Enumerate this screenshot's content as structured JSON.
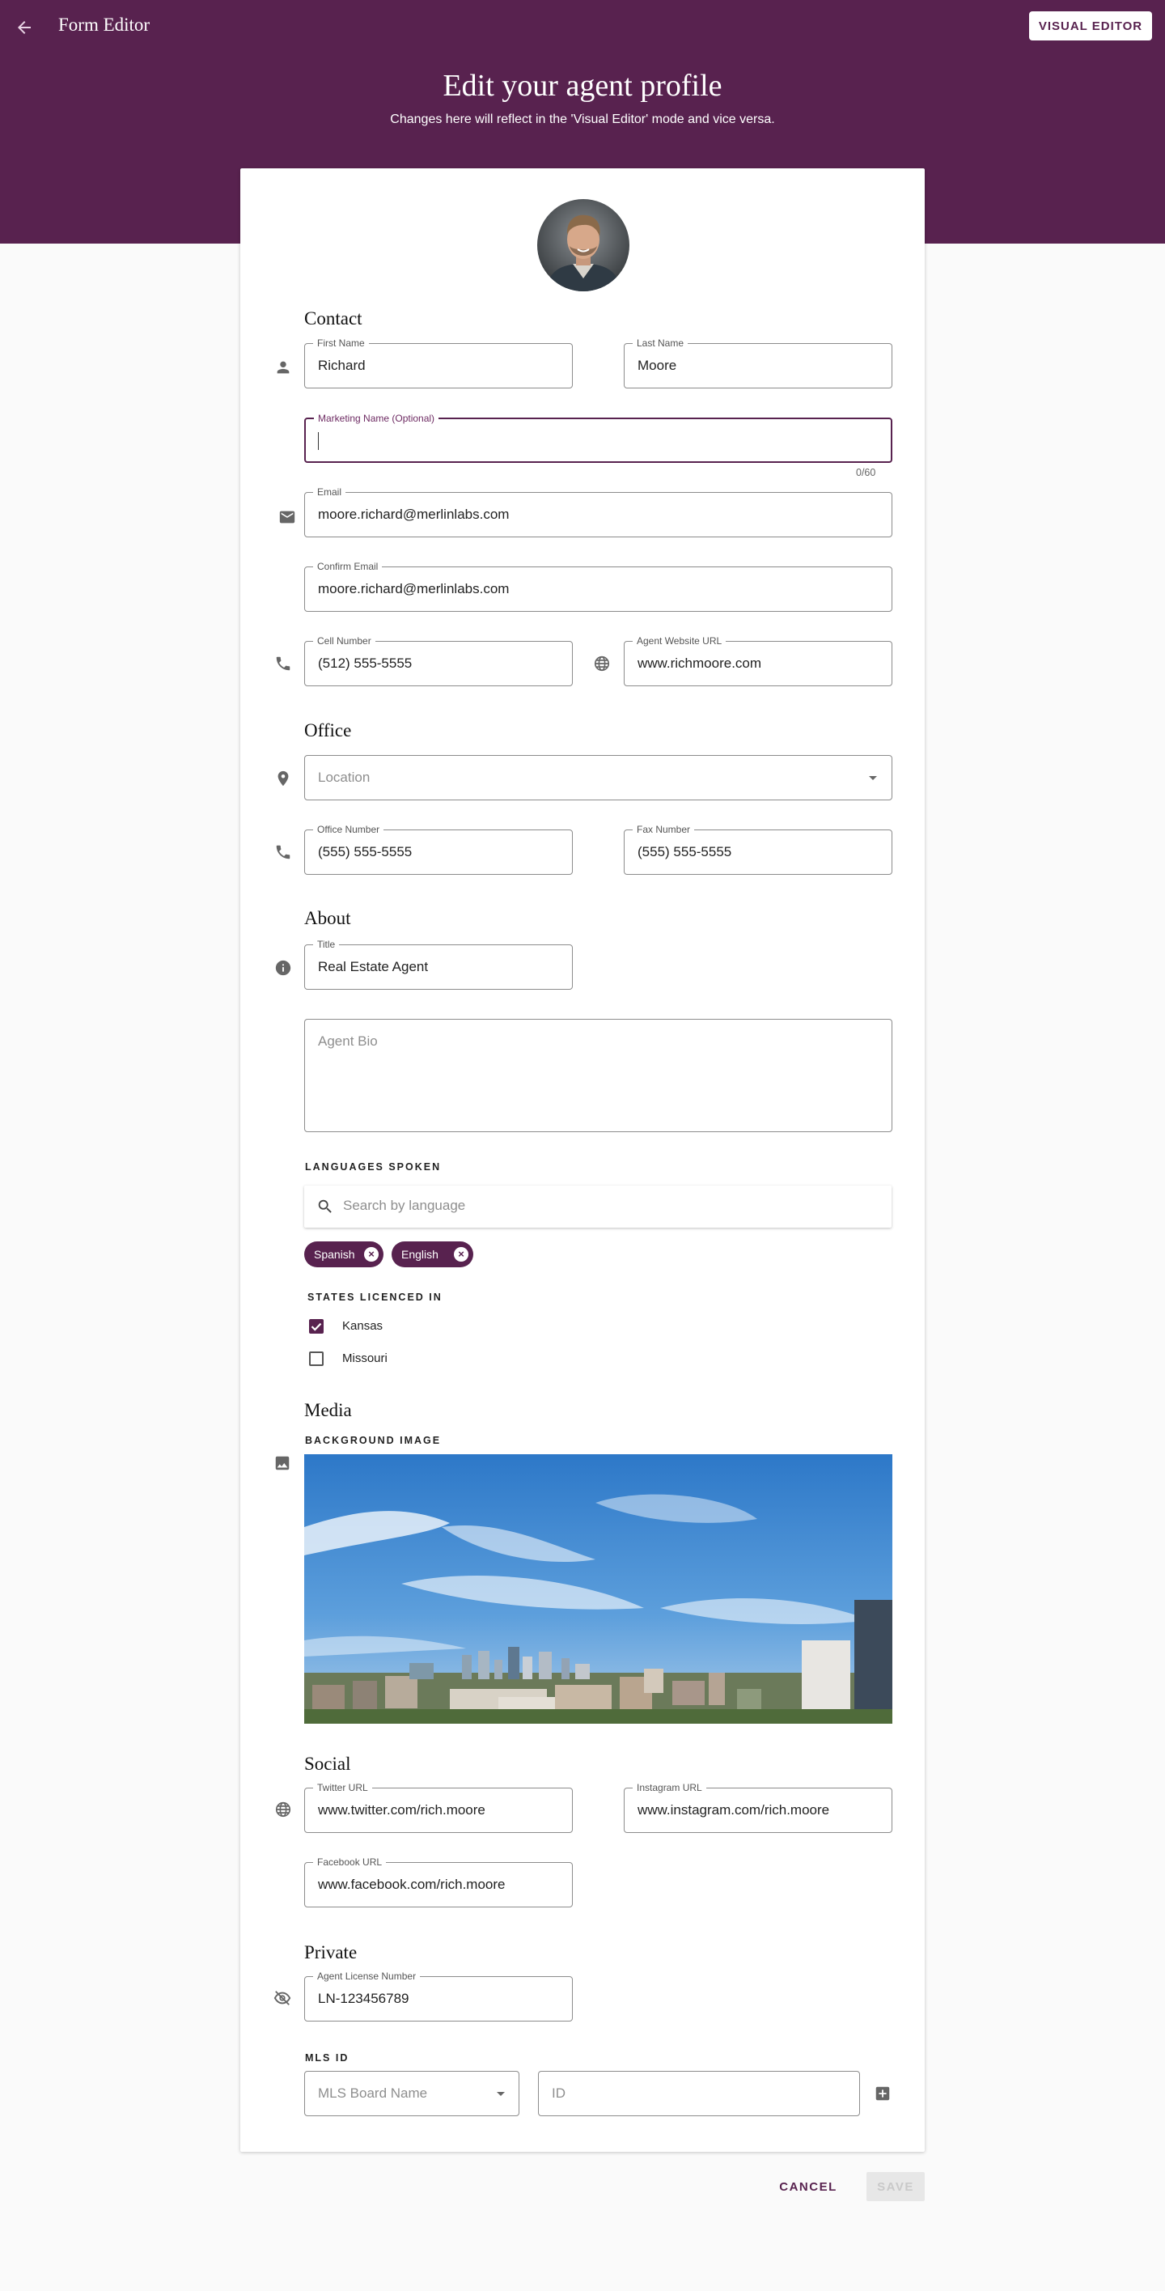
{
  "header": {
    "app_title": "Form Editor",
    "visual_editor_label": "VISUAL EDITOR",
    "page_title": "Edit your agent profile",
    "page_subtitle": "Changes here will reflect in the 'Visual Editor' mode and vice versa."
  },
  "contact": {
    "heading": "Contact",
    "first_name": {
      "label": "First Name",
      "value": "Richard"
    },
    "last_name": {
      "label": "Last Name",
      "value": "Moore"
    },
    "marketing_name": {
      "label": "Marketing Name (Optional)",
      "value": "",
      "counter": "0/60"
    },
    "email": {
      "label": "Email",
      "value": "moore.richard@merlinlabs.com"
    },
    "confirm_email": {
      "label": "Confirm Email",
      "value": "moore.richard@merlinlabs.com"
    },
    "cell_number": {
      "label": "Cell Number",
      "value": "(512) 555-5555"
    },
    "website": {
      "label": "Agent Website URL",
      "value": "www.richmoore.com"
    }
  },
  "office": {
    "heading": "Office",
    "location": {
      "placeholder": "Location"
    },
    "office_number": {
      "label": "Office Number",
      "value": "(555) 555-5555"
    },
    "fax_number": {
      "label": "Fax Number",
      "value": "(555) 555-5555"
    }
  },
  "about": {
    "heading": "About",
    "title": {
      "label": "Title",
      "value": "Real Estate Agent"
    },
    "bio": {
      "placeholder": "Agent Bio"
    },
    "languages_label": "LANGUAGES SPOKEN",
    "language_search": {
      "placeholder": "Search by language"
    },
    "languages": [
      {
        "label": "Spanish"
      },
      {
        "label": "English"
      }
    ],
    "states_label": "STATES LICENCED IN",
    "states": [
      {
        "label": "Kansas",
        "checked": true
      },
      {
        "label": "Missouri",
        "checked": false
      }
    ]
  },
  "media": {
    "heading": "Media",
    "background_label": "BACKGROUND IMAGE"
  },
  "social": {
    "heading": "Social",
    "twitter": {
      "label": "Twitter URL",
      "value": "www.twitter.com/rich.moore"
    },
    "instagram": {
      "label": "Instagram URL",
      "value": "www.instagram.com/rich.moore"
    },
    "facebook": {
      "label": "Facebook URL",
      "value": "www.facebook.com/rich.moore"
    }
  },
  "private": {
    "heading": "Private",
    "license": {
      "label": "Agent License Number",
      "value": "LN-123456789"
    },
    "mls_label": "MLS  ID",
    "mls_board": {
      "placeholder": "MLS Board Name"
    },
    "mls_id": {
      "placeholder": "ID"
    }
  },
  "actions": {
    "cancel_label": "CANCEL",
    "save_label": "SAVE"
  },
  "colors": {
    "brand": "#58224f",
    "header_bg": "#58224f",
    "page_bg": "#fafafa",
    "save_disabled_bg": "#e7e7e7"
  },
  "icons": [
    "back-arrow-icon",
    "person-icon",
    "email-icon",
    "phone-icon",
    "globe-icon",
    "location-pin-icon",
    "info-icon",
    "search-icon",
    "remove-chip-icon",
    "image-icon",
    "visibility-off-icon",
    "add-box-icon"
  ]
}
